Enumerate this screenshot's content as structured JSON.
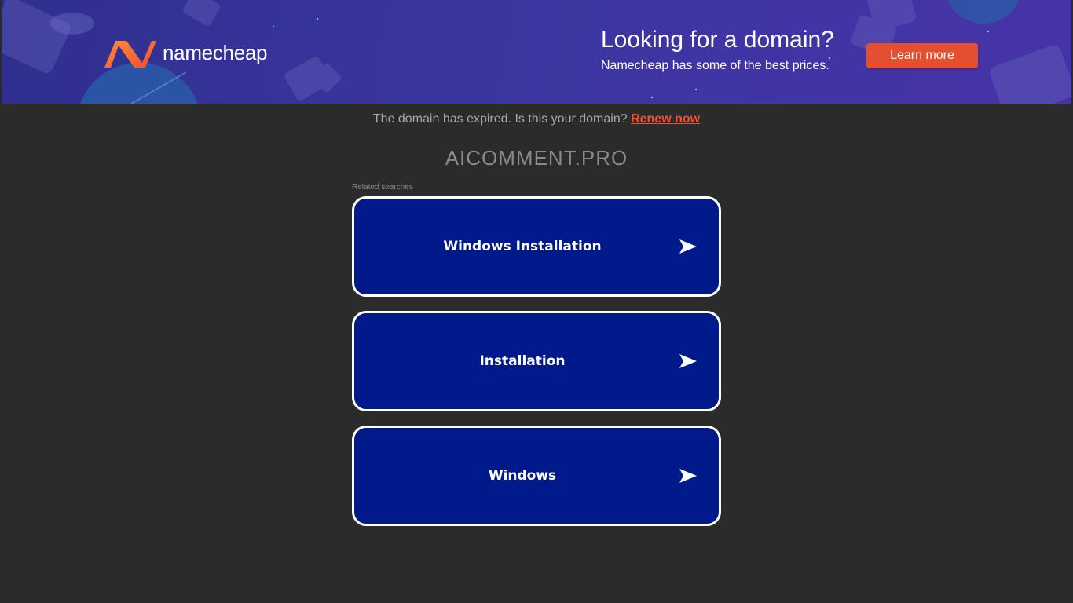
{
  "banner": {
    "brand": "namecheap",
    "title": "Looking for a domain?",
    "subtitle": "Namecheap has some of the best prices.",
    "cta_label": "Learn more"
  },
  "notice": {
    "text": "The domain has expired. Is this your domain?",
    "link_label": "Renew now"
  },
  "domain": "AICOMMENT.PRO",
  "related": {
    "label": "Related searches",
    "items": [
      {
        "label": "Windows Installation",
        "icon": "arrow-right-icon"
      },
      {
        "label": "Installation",
        "icon": "arrow-right-icon"
      },
      {
        "label": "Windows",
        "icon": "arrow-right-icon"
      }
    ]
  },
  "colors": {
    "background": "#2b2b2b",
    "banner": "#3a36a0",
    "cta": "#e4502f",
    "card": "#001a8c",
    "link": "#f0502f"
  }
}
